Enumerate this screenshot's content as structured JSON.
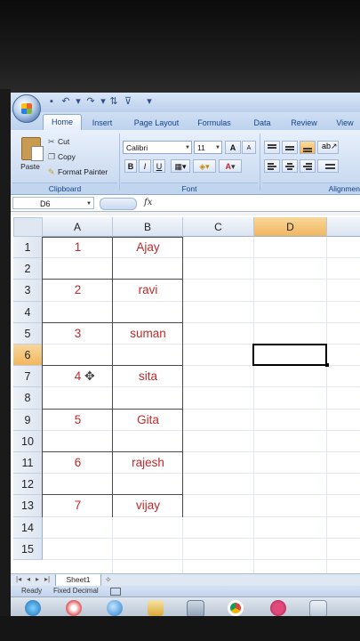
{
  "ribbon": {
    "tabs": [
      "Home",
      "Insert",
      "Page Layout",
      "Formulas",
      "Data",
      "Review",
      "View"
    ],
    "clipboard": {
      "paste": "Paste",
      "cut": "Cut",
      "copy": "Copy",
      "format_painter": "Format Painter",
      "label": "Clipboard"
    },
    "font": {
      "name": "Calibri",
      "size": "11",
      "label": "Font",
      "bold": "B",
      "italic": "I",
      "underline": "U",
      "grow": "A",
      "shrink": "A",
      "font_color": "A"
    },
    "alignment": {
      "label": "Alignmen"
    }
  },
  "formula_bar": {
    "name_box": "D6",
    "fx": "fx",
    "value": ""
  },
  "sheet": {
    "columns": [
      "A",
      "B",
      "C",
      "D"
    ],
    "selected_column": "D",
    "rows": [
      "1",
      "2",
      "3",
      "4",
      "5",
      "6",
      "7",
      "8",
      "9",
      "10",
      "11",
      "12",
      "13",
      "14",
      "15"
    ],
    "selected_row": "6",
    "cells": [
      {
        "row": "1",
        "a": "1",
        "b": "Ajay"
      },
      {
        "row": "2",
        "a": "",
        "b": ""
      },
      {
        "row": "3",
        "a": "2",
        "b": "ravi"
      },
      {
        "row": "4",
        "a": "",
        "b": ""
      },
      {
        "row": "5",
        "a": "3",
        "b": "suman"
      },
      {
        "row": "6",
        "a": "",
        "b": ""
      },
      {
        "row": "7",
        "a": "4",
        "b": "sita"
      },
      {
        "row": "8",
        "a": "",
        "b": ""
      },
      {
        "row": "9",
        "a": "5",
        "b": "Gita"
      },
      {
        "row": "10",
        "a": "",
        "b": ""
      },
      {
        "row": "11",
        "a": "6",
        "b": "rajesh"
      },
      {
        "row": "12",
        "a": "",
        "b": ""
      },
      {
        "row": "13",
        "a": "7",
        "b": "vijay"
      }
    ],
    "text_color": "#c0282c",
    "sheet_tab": "Sheet1"
  },
  "status": {
    "ready": "Ready",
    "mode": "Fixed Decimal"
  },
  "colors": {
    "ribbon": "#cddcf1",
    "header_selected": "#f1b760",
    "cell_text": "#c0282c"
  }
}
